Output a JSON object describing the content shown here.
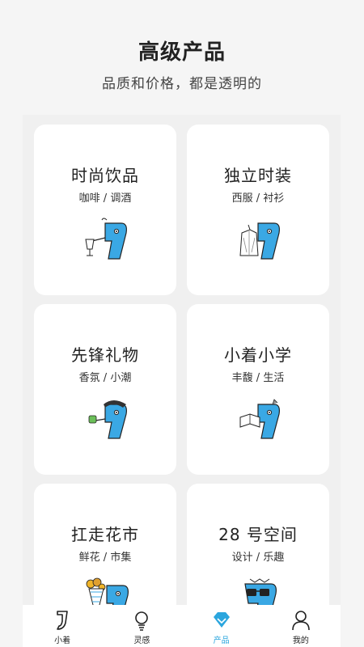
{
  "header": {
    "title": "高级产品",
    "subtitle": "品质和价格，都是透明的"
  },
  "cards": [
    {
      "title": "时尚饮品",
      "subtitle": "咖啡 / 调酒",
      "icon": "mascot-drink-icon"
    },
    {
      "title": "独立时装",
      "subtitle": "西服 / 衬衫",
      "icon": "mascot-fashion-icon"
    },
    {
      "title": "先锋礼物",
      "subtitle": "香氛 / 小潮",
      "icon": "mascot-gift-icon"
    },
    {
      "title": "小着小学",
      "subtitle": "丰馥 / 生活",
      "icon": "mascot-book-icon"
    },
    {
      "title": "扛走花市",
      "subtitle": "鲜花 / 市集",
      "icon": "mascot-flower-icon"
    },
    {
      "title": "28 号空间",
      "subtitle": "设计 / 乐趣",
      "icon": "mascot-glasses-icon"
    }
  ],
  "tabbar": {
    "items": [
      {
        "label": "小着",
        "icon": "logo-icon"
      },
      {
        "label": "灵感",
        "icon": "lightbulb-icon"
      },
      {
        "label": "产品",
        "icon": "diamond-icon",
        "active": true
      },
      {
        "label": "我的",
        "icon": "user-icon"
      }
    ]
  },
  "colors": {
    "accent": "#2ba6de",
    "mascot_blue": "#3aa8e4",
    "background": "#f5f5f5",
    "card": "#ffffff"
  }
}
